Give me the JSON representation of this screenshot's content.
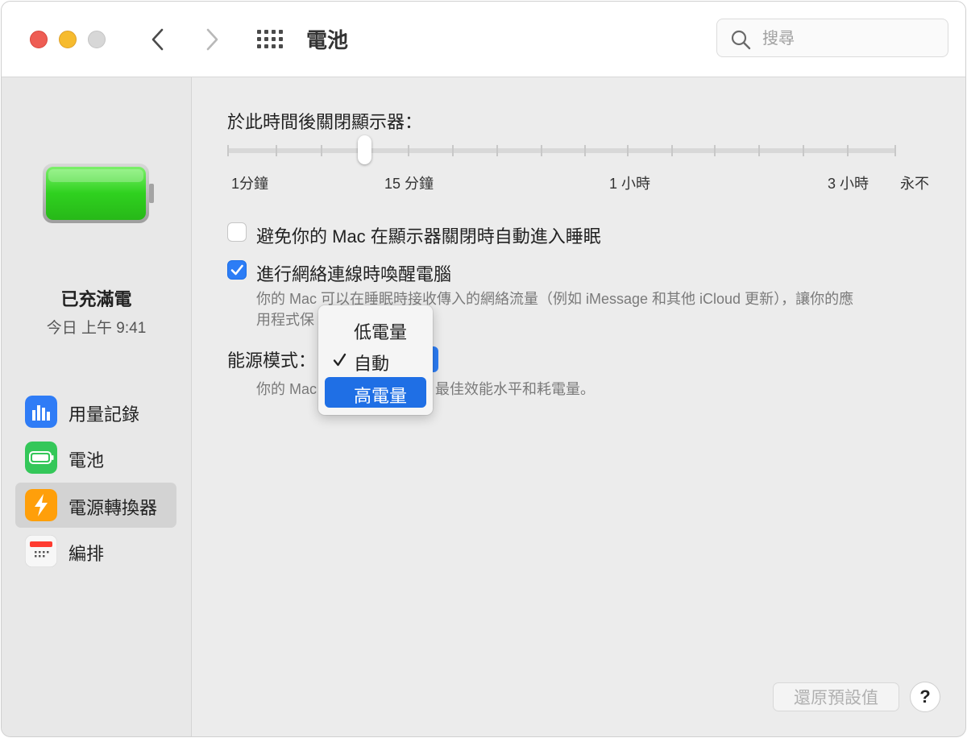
{
  "window": {
    "title": "電池"
  },
  "search": {
    "placeholder": "搜尋"
  },
  "sidebar": {
    "status_title": "已充滿電",
    "status_time": "今日 上午 9:41",
    "items": [
      {
        "label": "用量記錄",
        "icon": "bar-chart-icon",
        "color": "#2f7cf6"
      },
      {
        "label": "電池",
        "icon": "battery-icon",
        "color": "#34c759"
      },
      {
        "label": "電源轉換器",
        "icon": "bolt-icon",
        "color": "#ff9f0a",
        "active": true
      },
      {
        "label": "編排",
        "icon": "calendar-icon",
        "color": "#ff3b30"
      }
    ]
  },
  "display_off": {
    "title": "於此時間後關閉顯示器：",
    "ticks": [
      "1分鐘",
      "15 分鐘",
      "1 小時",
      "3 小時",
      "永不"
    ]
  },
  "options": {
    "prevent_sleep": {
      "label": "避免你的 Mac 在顯示器關閉時自動進入睡眠",
      "checked": false
    },
    "wake_network": {
      "label": "進行網絡連線時喚醒電腦",
      "checked": true,
      "desc_line1": "你的 Mac 可以在睡眠時接收傳入的網絡流量（例如 iMessage 和其他 iCloud 更新），讓你的應",
      "desc_line2": "用程式保"
    }
  },
  "energy_mode": {
    "label": "能源模式：",
    "desc_left": "你的 Mac",
    "desc_right": "最佳效能水平和耗電量。",
    "menu": [
      {
        "label": "低電量",
        "checked": false,
        "highlighted": false
      },
      {
        "label": "自動",
        "checked": true,
        "highlighted": false
      },
      {
        "label": "高電量",
        "checked": false,
        "highlighted": true
      }
    ]
  },
  "footer": {
    "restore_label": "還原預設值",
    "help_label": "?"
  },
  "colors": {
    "accent": "#2c7df6",
    "battery_green": "#3ddc2e"
  }
}
